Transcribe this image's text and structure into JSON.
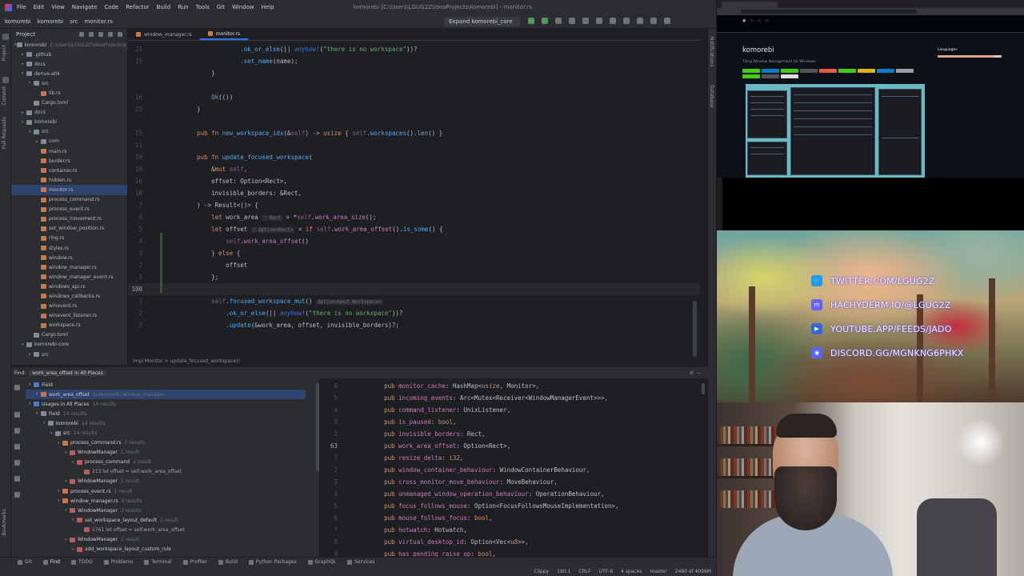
{
  "ide": {
    "menu": [
      "File",
      "Edit",
      "View",
      "Navigate",
      "Code",
      "Refactor",
      "Build",
      "Run",
      "Tools",
      "Git",
      "Window",
      "Help"
    ],
    "window_title": "komorebi [C:\\Users\\LGUG2Z\\IdeaProjects\\komorebi] - monitor.rs",
    "breadcrumb": [
      "komorebi",
      "komorebi",
      "src",
      "monitor.rs"
    ],
    "run_config": "Expand komorebi_core",
    "project_panel_title": "Project",
    "project_tree": [
      {
        "indent": 0,
        "kind": "folder",
        "label": "komorebi",
        "meta": "C:\\Users\\LGUG2Z\\IdeaProjects\\komorebi",
        "open": true
      },
      {
        "indent": 1,
        "kind": "folder",
        "label": ".github",
        "open": false
      },
      {
        "indent": 1,
        "kind": "folder",
        "label": "docs",
        "open": false
      },
      {
        "indent": 1,
        "kind": "folder",
        "label": "derive-ahk",
        "open": true
      },
      {
        "indent": 2,
        "kind": "folder",
        "label": "src",
        "open": true
      },
      {
        "indent": 3,
        "kind": "rs",
        "label": "lib.rs"
      },
      {
        "indent": 2,
        "kind": "toml",
        "label": "Cargo.toml"
      },
      {
        "indent": 1,
        "kind": "folder",
        "label": "docs",
        "open": false
      },
      {
        "indent": 1,
        "kind": "folder",
        "label": "komorebi",
        "open": true
      },
      {
        "indent": 2,
        "kind": "folder",
        "label": "src",
        "open": true
      },
      {
        "indent": 3,
        "kind": "folder",
        "label": "com",
        "open": false
      },
      {
        "indent": 3,
        "kind": "rs",
        "label": "main.rs"
      },
      {
        "indent": 3,
        "kind": "rs",
        "label": "border.rs"
      },
      {
        "indent": 3,
        "kind": "rs",
        "label": "container.rs"
      },
      {
        "indent": 3,
        "kind": "rs",
        "label": "hidden.rs"
      },
      {
        "indent": 3,
        "kind": "rs",
        "label": "monitor.rs",
        "selected": true
      },
      {
        "indent": 3,
        "kind": "rs",
        "label": "process_command.rs"
      },
      {
        "indent": 3,
        "kind": "rs",
        "label": "process_event.rs"
      },
      {
        "indent": 3,
        "kind": "rs",
        "label": "process_movement.rs"
      },
      {
        "indent": 3,
        "kind": "rs",
        "label": "set_window_position.rs"
      },
      {
        "indent": 3,
        "kind": "rs",
        "label": "ring.rs"
      },
      {
        "indent": 3,
        "kind": "rs",
        "label": "styles.rs"
      },
      {
        "indent": 3,
        "kind": "rs",
        "label": "window.rs"
      },
      {
        "indent": 3,
        "kind": "rs",
        "label": "window_manager.rs"
      },
      {
        "indent": 3,
        "kind": "rs",
        "label": "window_manager_event.rs"
      },
      {
        "indent": 3,
        "kind": "rs",
        "label": "windows_api.rs"
      },
      {
        "indent": 3,
        "kind": "rs",
        "label": "windows_callbacks.rs"
      },
      {
        "indent": 3,
        "kind": "rs",
        "label": "winevent.rs"
      },
      {
        "indent": 3,
        "kind": "rs",
        "label": "winevent_listener.rs"
      },
      {
        "indent": 3,
        "kind": "rs",
        "label": "workspace.rs"
      },
      {
        "indent": 2,
        "kind": "toml",
        "label": "Cargo.toml"
      },
      {
        "indent": 1,
        "kind": "folder",
        "label": "komorebi-core",
        "open": true
      },
      {
        "indent": 2,
        "kind": "folder",
        "label": "src",
        "open": false
      }
    ],
    "tabs": [
      {
        "label": "window_manager.rs",
        "active": false
      },
      {
        "label": "monitor.rs",
        "active": true
      }
    ],
    "code_lines": [
      {
        "ln": "21",
        "html": "                <span class=\"fn\">.ok_or_else</span>(|| <span class=\"mac\">anyhow!</span>(<span class=\"str\">\"there is no workspace\"</span>))?",
        "cur": false
      },
      {
        "ln": "15",
        "html": "                <span class=\"fn\">.set_name</span>(name);",
        "cur": false
      },
      {
        "ln": "",
        "html": "        }",
        "cur": false
      },
      {
        "ln": "",
        "html": "",
        "cur": false
      },
      {
        "ln": "16",
        "html": "        <span class=\"fn\">Ok</span>(())",
        "cur": false
      },
      {
        "ln": "15",
        "html": "    }",
        "cur": false
      },
      {
        "ln": "",
        "html": "",
        "cur": false
      },
      {
        "ln": "15",
        "html": "    <span class=\"kw\">pub fn</span> <span class=\"fn\">new_workspace_idx</span>(&amp;<span class=\"self\">self</span>) -&gt; <span class=\"kw\">usize</span> { <span class=\"self\">self</span>.<span class=\"fn\">workspaces</span>().<span class=\"fn\">len</span>() }",
        "cur": false
      },
      {
        "ln": "11",
        "html": "",
        "cur": false
      },
      {
        "ln": "10",
        "html": "    <span class=\"kw\">pub fn</span> <span class=\"fn\">update_focused_workspace</span>(",
        "cur": false
      },
      {
        "ln": "10",
        "html": "        &amp;<span class=\"kw\">mut</span> <span class=\"self\">self</span>,",
        "cur": false
      },
      {
        "ln": "10",
        "html": "        offset: Option&lt;Rect&gt;,",
        "cur": false
      },
      {
        "ln": "10",
        "html": "        invisible_borders: &amp;Rect,",
        "cur": false
      },
      {
        "ln": "7",
        "html": "    ) -&gt; Result&lt;()&gt; {",
        "cur": false
      },
      {
        "ln": "6",
        "html": "        <span class=\"kw\">let</span> work_area <span class=\"hint\">: Rect</span> = *<span class=\"self\">self</span>.<span class=\"fld\">work_area_size</span>();",
        "cur": false
      },
      {
        "ln": "5",
        "html": "        <span class=\"kw\">let</span> offset <span class=\"hint\">: Option&lt;Rect&gt;</span> = <span class=\"kw\">if</span> <span class=\"self\">self</span>.<span class=\"fld\">work_area_offset</span>().<span class=\"fn\">is_some</span>() {",
        "cur": false
      },
      {
        "ln": "4",
        "html": "            <span class=\"self\">self</span>.<span class=\"fld\">work_area_offset</span>()",
        "cur": false
      },
      {
        "ln": "3",
        "html": "        } <span class=\"kw\">else</span> {",
        "cur": false
      },
      {
        "ln": "2",
        "html": "            offset",
        "cur": false
      },
      {
        "ln": "1",
        "html": "        };",
        "cur": false
      },
      {
        "ln": "100",
        "html": "",
        "cur": true
      },
      {
        "ln": "1",
        "html": "        <span class=\"self\">self</span>.<span class=\"fn\">focused_workspace_mut</span>() <span class=\"hint\">Option&lt;&amp;mut Workspace&gt;</span>",
        "cur": false
      },
      {
        "ln": "2",
        "html": "            <span class=\"fn\">.ok_or_else</span>(|| <span class=\"mac\">anyhow!</span>(<span class=\"str\">\"there is no workspace\"</span>))?",
        "cur": false
      },
      {
        "ln": "3",
        "html": "            <span class=\"fn\">.update</span>(&amp;work_area, offset, invisible_borders)?;",
        "cur": false
      },
      {
        "ln": "",
        "html": "",
        "cur": false
      }
    ],
    "editor_breadcrumb": "impl Monitor  >  update_focused_workspace()",
    "find": {
      "title": "Find:",
      "tab": "work_area_offset in All Places",
      "tree": [
        {
          "indent": 0,
          "label": "Field",
          "sel": false,
          "kind": "none"
        },
        {
          "indent": 1,
          "label": "work_area_offset",
          "meta": "in komorebi.window_manager",
          "sel": true,
          "kind": "rs"
        },
        {
          "indent": 0,
          "label": "Usages in All Places",
          "meta": "14 results",
          "sel": false,
          "kind": "none"
        },
        {
          "indent": 1,
          "label": "Field",
          "meta": "14 results",
          "sel": false,
          "kind": "folder"
        },
        {
          "indent": 2,
          "label": "komorebi",
          "meta": "14 results",
          "sel": false,
          "kind": "folder"
        },
        {
          "indent": 3,
          "label": "src",
          "meta": "14 results",
          "sel": false,
          "kind": "folder"
        },
        {
          "indent": 4,
          "label": "process_command.rs",
          "meta": "2 results",
          "sel": false,
          "kind": "rs"
        },
        {
          "indent": 5,
          "label": "WindowManager",
          "meta": "1 result",
          "sel": false,
          "kind": "none"
        },
        {
          "indent": 6,
          "label": "process_command",
          "meta": "1 result",
          "sel": false,
          "kind": "none"
        },
        {
          "indent": 7,
          "label": "213 let offset = self.work_area_offset",
          "sel": false,
          "kind": "none"
        },
        {
          "indent": 5,
          "label": "WindowManager",
          "meta": "1 result",
          "sel": false,
          "kind": "none"
        },
        {
          "indent": 4,
          "label": "process_event.rs",
          "meta": "1 result",
          "sel": false,
          "kind": "rs"
        },
        {
          "indent": 4,
          "label": "window_manager.rs",
          "meta": "8 results",
          "sel": false,
          "kind": "rs"
        },
        {
          "indent": 5,
          "label": "WindowManager",
          "meta": "3 results",
          "sel": false,
          "kind": "none"
        },
        {
          "indent": 6,
          "label": "set_workspace_layout_default",
          "meta": "1 result",
          "sel": false,
          "kind": "none"
        },
        {
          "indent": 7,
          "label": "1761 let offset = self.work_area_offset",
          "sel": false,
          "kind": "none"
        },
        {
          "indent": 5,
          "label": "WindowManager",
          "meta": "1 result",
          "sel": false,
          "kind": "none"
        },
        {
          "indent": 6,
          "label": "add_workspace_layout_custom_rule",
          "sel": false,
          "kind": "none"
        }
      ],
      "preview_lines": [
        {
          "ln": "6",
          "html": "    <span class=\"kw\">pub</span> <span class=\"fld\">monitor_cache</span>: HashMap&lt;<span class=\"kw\">usize</span>, Monitor&gt;,",
          "cur": false
        },
        {
          "ln": "5",
          "html": "    <span class=\"kw\">pub</span> <span class=\"fld\">incoming_events</span>: Arc&lt;Mutex&lt;Receiver&lt;WindowManagerEvent&gt;&gt;&gt;,",
          "cur": false
        },
        {
          "ln": "4",
          "html": "    <span class=\"kw\">pub</span> <span class=\"fld\">command_listener</span>: UnixListener,",
          "cur": false
        },
        {
          "ln": "3",
          "html": "    <span class=\"kw\">pub</span> <span class=\"fld\">is_paused</span>: <span class=\"kw\">bool</span>,",
          "cur": false
        },
        {
          "ln": "2",
          "html": "    <span class=\"kw\">pub</span> <span class=\"fld\">invisible_borders</span>: Rect,",
          "cur": false
        },
        {
          "ln": "63",
          "html": "    <span class=\"kw\">pub</span> <span class=\"fld\">work_area_offset</span>: Option&lt;Rect&gt;,",
          "cur": true
        },
        {
          "ln": "1",
          "html": "    <span class=\"kw\">pub</span> <span class=\"fld\">resize_delta</span>: <span class=\"kw\">i32</span>,",
          "cur": false
        },
        {
          "ln": "2",
          "html": "    <span class=\"kw\">pub</span> <span class=\"fld\">window_container_behaviour</span>: WindowContainerBehaviour,",
          "cur": false
        },
        {
          "ln": "3",
          "html": "    <span class=\"kw\">pub</span> <span class=\"fld\">cross_monitor_move_behaviour</span>: MoveBehaviour,",
          "cur": false
        },
        {
          "ln": "4",
          "html": "    <span class=\"kw\">pub</span> <span class=\"fld\">unmanaged_window_operation_behaviour</span>: OperationBehaviour,",
          "cur": false
        },
        {
          "ln": "5",
          "html": "    <span class=\"kw\">pub</span> <span class=\"fld\">focus_follows_mouse</span>: Option&lt;FocusFollowsMouseImplementation&gt;,",
          "cur": false
        },
        {
          "ln": "6",
          "html": "    <span class=\"kw\">pub</span> <span class=\"fld\">mouse_follows_focus</span>: <span class=\"kw\">bool</span>,",
          "cur": false
        },
        {
          "ln": "7",
          "html": "    <span class=\"kw\">pub</span> <span class=\"fld\">hotwatch</span>: Hotwatch,",
          "cur": false
        },
        {
          "ln": "8",
          "html": "    <span class=\"kw\">pub</span> <span class=\"fld\">virtual_desktop_id</span>: Option&lt;Vec&lt;<span class=\"kw\">u8</span>&gt;&gt;,",
          "cur": false
        },
        {
          "ln": "9",
          "html": "    <span class=\"kw\">pub</span> <span class=\"fld\">has_pending_raise_op</span>: <span class=\"kw\">bool</span>,",
          "cur": false
        }
      ]
    },
    "bottom_tools": [
      {
        "label": "Git",
        "on": false
      },
      {
        "label": "Find",
        "on": true
      },
      {
        "label": "TODO",
        "on": false
      },
      {
        "label": "Problems",
        "on": false
      },
      {
        "label": "Terminal",
        "on": false
      },
      {
        "label": "Profiler",
        "on": false
      },
      {
        "label": "Build",
        "on": false
      },
      {
        "label": "Python Packages",
        "on": false
      },
      {
        "label": "GraphQL",
        "on": false
      },
      {
        "label": "Services",
        "on": false
      }
    ],
    "status": [
      "Clippy",
      "190:1",
      "CRLF",
      "UTF-8",
      "4 spaces",
      "master",
      "2480 of 4096M"
    ]
  },
  "browser": {
    "repo_name": "komorebi",
    "tagline": "Tiling Window Management for Windows.",
    "sidebar_label": "Languages"
  },
  "socials": [
    {
      "icon": "twitter-icon",
      "text": "TWITTER.COM/LGUG2Z"
    },
    {
      "icon": "mastodon-icon",
      "text": "HACHYDERM.IO/@LGUG2Z"
    },
    {
      "icon": "youtube-icon",
      "text": "YOUTUBE.APP/FEEDS/JADO"
    },
    {
      "icon": "discord-icon",
      "text": "DISCORD.GG/MGNKNG6PHKX"
    }
  ]
}
